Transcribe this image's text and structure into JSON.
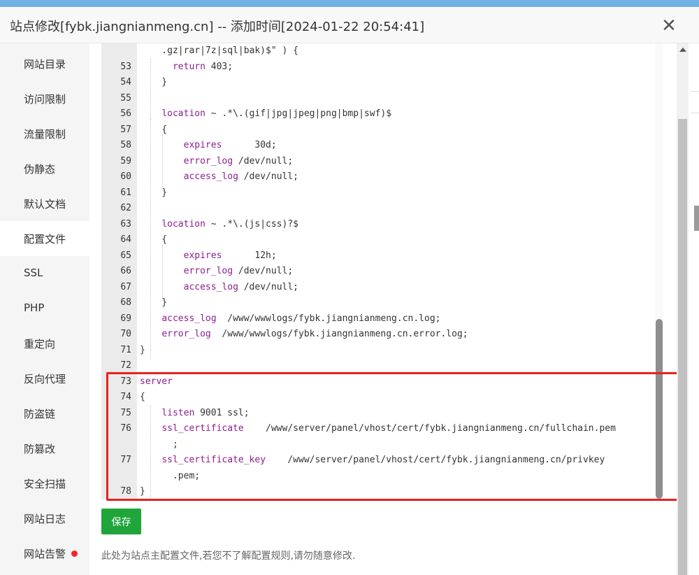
{
  "dialog": {
    "title": "站点修改[fybk.jiangnianmeng.cn] -- 添加时间[2024-01-22 20:54:41]",
    "close_glyph": "✕"
  },
  "sidebar": {
    "items": [
      {
        "label": "网站目录"
      },
      {
        "label": "访问限制"
      },
      {
        "label": "流量限制"
      },
      {
        "label": "伪静态"
      },
      {
        "label": "默认文档"
      },
      {
        "label": "配置文件",
        "active": true
      },
      {
        "label": "SSL"
      },
      {
        "label": "PHP"
      },
      {
        "label": "重定向"
      },
      {
        "label": "反向代理"
      },
      {
        "label": "防盗链"
      },
      {
        "label": "防篡改"
      },
      {
        "label": "安全扫描"
      },
      {
        "label": "网站日志"
      },
      {
        "label": "网站告警",
        "badge": true
      }
    ]
  },
  "editor": {
    "lines": [
      {
        "n": "",
        "t": "    .gz|rar|7z|sql|bak)$\" ) {"
      },
      {
        "n": "53",
        "t": "      return 403;"
      },
      {
        "n": "54",
        "t": "    }"
      },
      {
        "n": "55",
        "t": ""
      },
      {
        "n": "56",
        "t": "    location ~ .*\\.(gif|jpg|jpeg|png|bmp|swf)$"
      },
      {
        "n": "57",
        "t": "    {"
      },
      {
        "n": "58",
        "t": "        expires      30d;"
      },
      {
        "n": "59",
        "t": "        error_log /dev/null;"
      },
      {
        "n": "60",
        "t": "        access_log /dev/null;"
      },
      {
        "n": "61",
        "t": "    }"
      },
      {
        "n": "62",
        "t": ""
      },
      {
        "n": "63",
        "t": "    location ~ .*\\.(js|css)?$"
      },
      {
        "n": "64",
        "t": "    {"
      },
      {
        "n": "65",
        "t": "        expires      12h;"
      },
      {
        "n": "66",
        "t": "        error_log /dev/null;"
      },
      {
        "n": "67",
        "t": "        access_log /dev/null;"
      },
      {
        "n": "68",
        "t": "    }"
      },
      {
        "n": "69",
        "t": "    access_log  /www/wwwlogs/fybk.jiangnianmeng.cn.log;"
      },
      {
        "n": "70",
        "t": "    error_log  /www/wwwlogs/fybk.jiangnianmeng.cn.error.log;"
      },
      {
        "n": "71",
        "t": "}"
      },
      {
        "n": "72",
        "t": ""
      },
      {
        "n": "73",
        "t": "server"
      },
      {
        "n": "74",
        "t": "{"
      },
      {
        "n": "75",
        "t": "    listen 9001 ssl;"
      },
      {
        "n": "76",
        "t": "    ssl_certificate    /www/server/panel/vhost/cert/fybk.jiangnianmeng.cn/fullchain.pem"
      },
      {
        "n": "",
        "t": "      ;"
      },
      {
        "n": "77",
        "t": "    ssl_certificate_key    /www/server/panel/vhost/cert/fybk.jiangnianmeng.cn/privkey"
      },
      {
        "n": "",
        "t": "      .pem;"
      },
      {
        "n": "78",
        "t": "}"
      }
    ]
  },
  "actions": {
    "save_label": "保存"
  },
  "hint": "此处为站点主配置文件,若您不了解配置规则,请勿随意修改.",
  "colors": {
    "save_green": "#20a53a",
    "highlight_red": "#e8221f",
    "keyword_purple": "#8b1f8f"
  }
}
